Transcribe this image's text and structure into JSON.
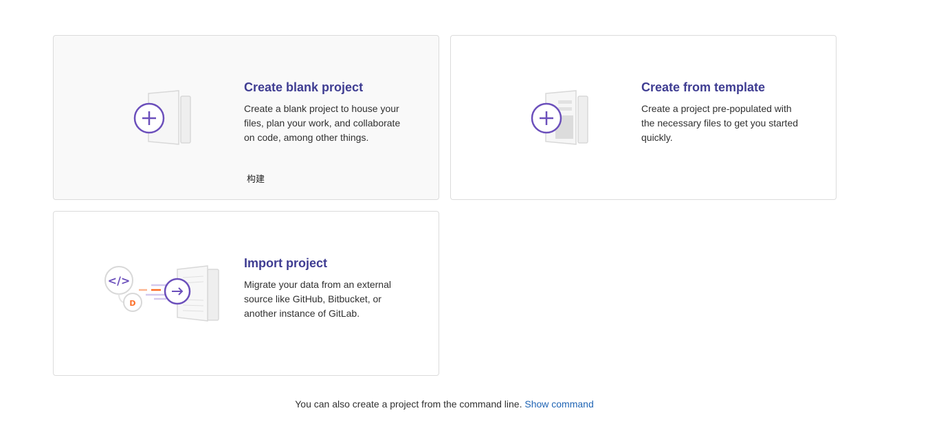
{
  "cards": [
    {
      "title": "Create blank project",
      "description": "Create a blank project to house your files, plan your work, and collaborate on code, among other things.",
      "footer_label": "构建",
      "icon": "blank-project-icon"
    },
    {
      "title": "Create from template",
      "description": "Create a project pre-populated with the necessary files to get you started quickly.",
      "icon": "template-project-icon"
    },
    {
      "title": "Import project",
      "description": "Migrate your data from an external source like GitHub, Bitbucket, or another instance of GitLab.",
      "icon": "import-project-icon"
    }
  ],
  "footer": {
    "text": "You can also create a project from the command line.",
    "link": "Show command"
  },
  "colors": {
    "accent": "#6b4fbb",
    "title": "#3f3d92",
    "link": "#1f64b4",
    "orange": "#fc6d26"
  }
}
